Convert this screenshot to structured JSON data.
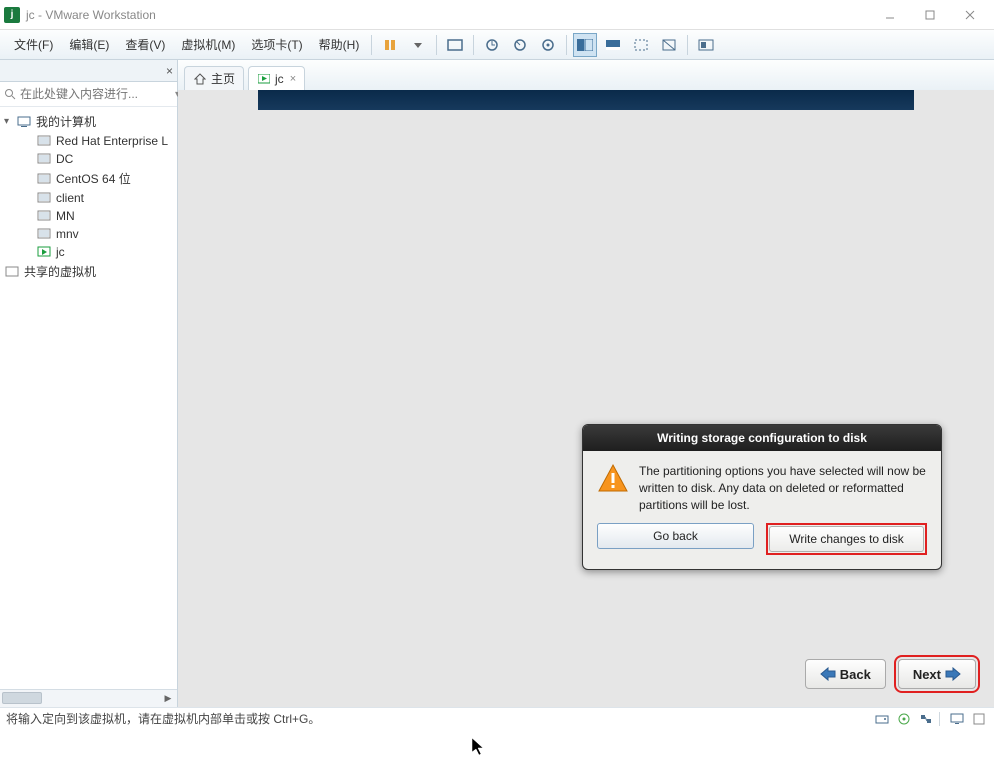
{
  "window": {
    "title": "jc - VMware Workstation"
  },
  "menu": {
    "file": "文件(F)",
    "edit": "编辑(E)",
    "view": "查看(V)",
    "vm": "虚拟机(M)",
    "tabs": "选项卡(T)",
    "help": "帮助(H)"
  },
  "sidebar": {
    "search_placeholder": "在此处键入内容进行...",
    "root": "我的计算机",
    "items": [
      "Red Hat Enterprise L",
      "DC",
      "CentOS 64 位",
      "client",
      "MN",
      "mnv",
      "jc"
    ],
    "shared": "共享的虚拟机"
  },
  "tabs": {
    "home": "主页",
    "vm": "jc"
  },
  "dialog": {
    "title": "Writing storage configuration to disk",
    "message": "The partitioning options you have selected will now be written to disk.  Any data on deleted or reformatted partitions will be lost.",
    "go_back": "Go back",
    "write": "Write changes to disk"
  },
  "nav": {
    "back": "Back",
    "next": "Next"
  },
  "status": {
    "text": "将输入定向到该虚拟机，请在虚拟机内部单击或按 Ctrl+G。"
  }
}
